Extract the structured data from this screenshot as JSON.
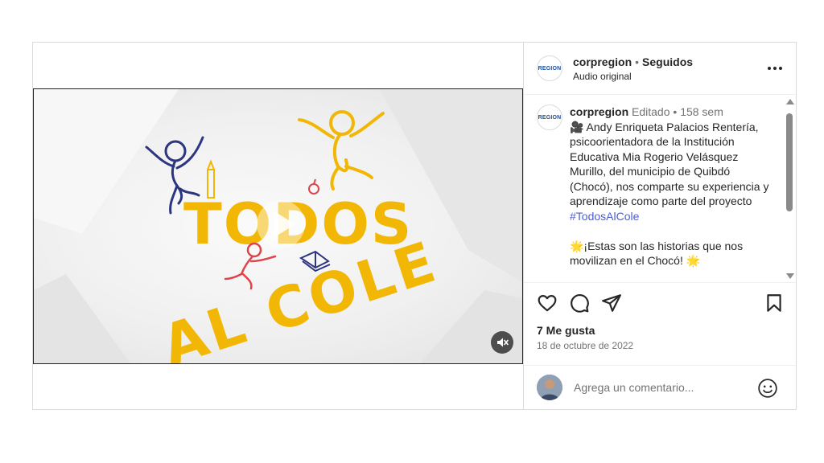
{
  "media": {
    "video": {
      "title_line1": "TODOS",
      "title_line2": "AL COLE",
      "colors": {
        "title": "#f2b705",
        "figure_blue": "#2b3580",
        "figure_yellow": "#f2b705",
        "figure_red": "#e0444b"
      }
    },
    "play_icon": "play-icon",
    "mute_icon": "speaker-muted-icon"
  },
  "header": {
    "avatar_text": "REGION",
    "username": "corpregion",
    "separator": "•",
    "follow_status": "Seguidos",
    "subtitle": "Audio original",
    "more_icon": "more-horizontal-icon"
  },
  "caption": {
    "avatar_text": "REGION",
    "username": "corpregion",
    "edited": "Editado",
    "separator": "•",
    "age": "158 sem",
    "body_1": "🎥 Andy Enriqueta Palacios Rentería, psicoorientadora de la Institución Educativa Mia Rogerio Velásquez Murillo, del municipio de Quibdó (Chocó), nos comparte su experiencia y aprendizaje como parte del proyecto",
    "hashtag": "#TodosAlCole",
    "body_2": "🌟¡Estas son las historias que nos movilizan en el Chocó! 🌟"
  },
  "actions": {
    "icons": [
      "heart-icon",
      "comment-icon",
      "share-icon",
      "bookmark-icon"
    ],
    "likes": "7 Me gusta",
    "date": "18 de octubre de 2022"
  },
  "comment": {
    "placeholder": "Agrega un comentario...",
    "emoji_icon": "emoji-icon"
  }
}
